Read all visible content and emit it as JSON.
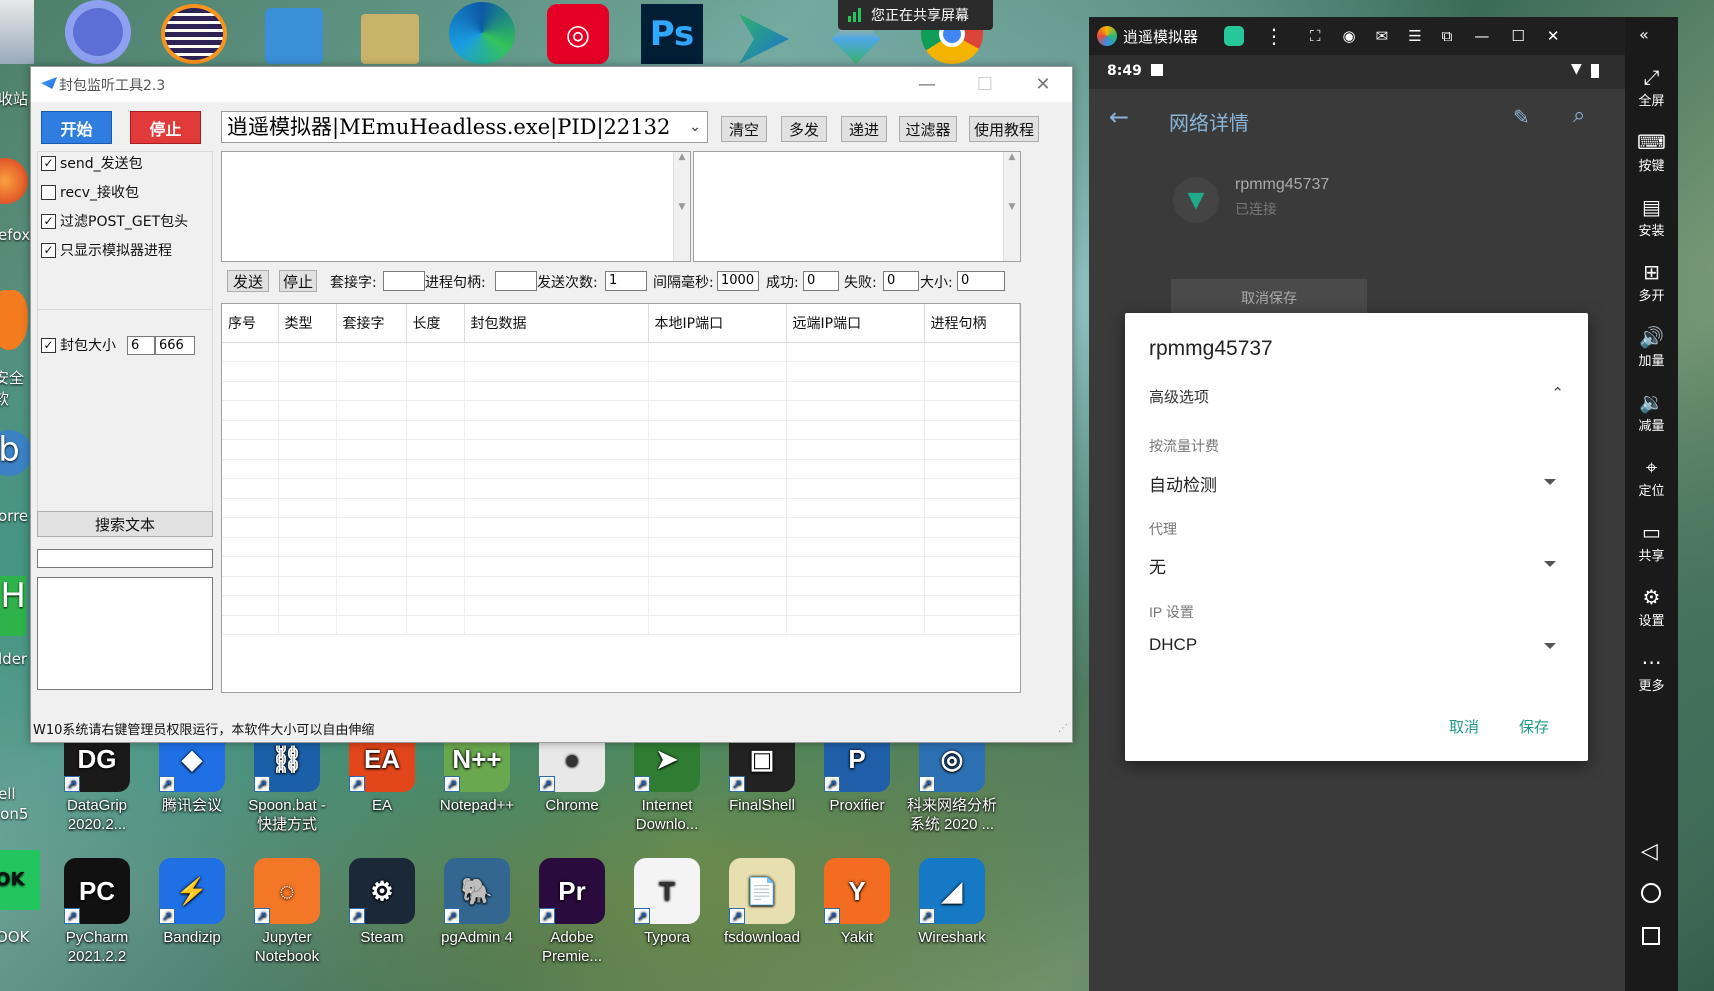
{
  "share_banner": {
    "text": "您正在共享屏幕"
  },
  "desktop_left_fragments": [
    "收站",
    "efox",
    "安全软",
    "orre",
    "lder",
    "ell",
    "ion5",
    "OOK"
  ],
  "desktop_row1": [
    {
      "label": "DataGrip 2020.2...",
      "color": "#1a1a1a",
      "glyph": "DG"
    },
    {
      "label": "腾讯会议",
      "color": "#1f6fe5",
      "glyph": "◆"
    },
    {
      "label": "Spoon.bat - 快捷方式",
      "color": "#1b5fa8",
      "glyph": "⛓"
    },
    {
      "label": "EA",
      "color": "#e2461a",
      "glyph": "EA"
    },
    {
      "label": "Notepad++",
      "color": "#6aa84f",
      "glyph": "N++"
    },
    {
      "label": "Chrome",
      "color": "#e8e8e8",
      "glyph": "●"
    },
    {
      "label": "Internet Downlo...",
      "color": "#2f7d32",
      "glyph": "➤"
    },
    {
      "label": "FinalShell",
      "color": "#222",
      "glyph": "▣"
    },
    {
      "label": "Proxifier",
      "color": "#1f5faa",
      "glyph": "P"
    },
    {
      "label": "科来网络分析系统 2020 ...",
      "color": "#2d6fb3",
      "glyph": "◎"
    }
  ],
  "desktop_row2": [
    {
      "label": "PyCharm 2021.2.2",
      "color": "#111",
      "glyph": "PC"
    },
    {
      "label": "Bandizip",
      "color": "#1f6fe5",
      "glyph": "⚡"
    },
    {
      "label": "Jupyter Notebook",
      "color": "#f37726",
      "glyph": "◌"
    },
    {
      "label": "Steam",
      "color": "#1b2838",
      "glyph": "⚙"
    },
    {
      "label": "pgAdmin 4",
      "color": "#336791",
      "glyph": "🐘"
    },
    {
      "label": "Adobe Premie...",
      "color": "#2b0a3d",
      "glyph": "Pr"
    },
    {
      "label": "Typora",
      "color": "#f4f4f4",
      "glyph": "T"
    },
    {
      "label": "fsdownload",
      "color": "#e8dfb0",
      "glyph": "📄"
    },
    {
      "label": "Yakit",
      "color": "#f36c21",
      "glyph": "Y"
    },
    {
      "label": "Wireshark",
      "color": "#1679c5",
      "glyph": "◢"
    }
  ],
  "tool": {
    "title": "封包监听工具2.3",
    "start": "开始",
    "stop": "停止",
    "process_select": "逍遥模拟器|MEmuHeadless.exe|PID|22132",
    "toolbar": [
      "清空",
      "多发",
      "递进",
      "过滤器",
      "使用教程"
    ],
    "checks": [
      {
        "label": "send_发送包",
        "checked": true
      },
      {
        "label": "recv_接收包",
        "checked": false
      },
      {
        "label": "过滤POST_GET包头",
        "checked": true
      },
      {
        "label": "只显示模拟器进程",
        "checked": true
      }
    ],
    "size_check": {
      "label": "封包大小",
      "checked": true,
      "min": "6",
      "max": "666"
    },
    "send_btn": "发送",
    "stop_send_btn": "停止",
    "socket_label": "套接字:",
    "handle_label": "进程句柄:",
    "count_label": "发送次数:",
    "count_value": "1",
    "interval_label": "间隔毫秒:",
    "interval_value": "1000",
    "ok_label": "成功:",
    "ok_value": "0",
    "fail_label": "失败:",
    "fail_value": "0",
    "size_label": "大小:",
    "size_value": "0",
    "search_btn": "搜索文本",
    "columns": [
      "序号",
      "类型",
      "套接字",
      "长度",
      "封包数据",
      "本地IP端口",
      "远端IP端口",
      "进程句柄"
    ],
    "status": "W10系统请右键管理员权限运行，本软件大小可以自由伸缩"
  },
  "emulator": {
    "title": "逍遥模拟器",
    "time": "8:49",
    "page_title": "网络详情",
    "network_name": "rpmmg45737",
    "network_status": "已连接",
    "cancel_save": "取消保存",
    "sidebar": [
      {
        "icon": "⤢",
        "label": "全屏"
      },
      {
        "icon": "⌨",
        "label": "按键"
      },
      {
        "icon": "▤",
        "label": "安装"
      },
      {
        "icon": "⊞",
        "label": "多开"
      },
      {
        "icon": "🔊",
        "label": "加量"
      },
      {
        "icon": "🔉",
        "label": "减量"
      },
      {
        "icon": "⌖",
        "label": "定位"
      },
      {
        "icon": "▭",
        "label": "共享"
      },
      {
        "icon": "⚙",
        "label": "设置"
      },
      {
        "icon": "⋯",
        "label": "更多"
      }
    ],
    "dialog": {
      "title": "rpmmg45737",
      "advanced": "高级选项",
      "metered_label": "按流量计费",
      "metered_value": "自动检测",
      "proxy_label": "代理",
      "proxy_value": "无",
      "ip_label": "IP 设置",
      "ip_value": "DHCP",
      "cancel": "取消",
      "save": "保存"
    }
  }
}
